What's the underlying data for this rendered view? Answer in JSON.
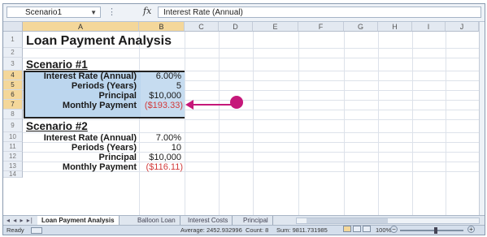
{
  "formula_bar": {
    "name_box": "Scenario1",
    "fx_label": "fx",
    "formula": "Interest Rate (Annual)"
  },
  "columns": [
    "A",
    "B",
    "C",
    "D",
    "E",
    "F",
    "G",
    "H",
    "I",
    "J"
  ],
  "rows": [
    "1",
    "2",
    "3",
    "4",
    "5",
    "6",
    "7",
    "8",
    "9",
    "10",
    "11",
    "12",
    "13",
    "14"
  ],
  "sheet": {
    "title": "Loan Payment Analysis",
    "scenario1": {
      "heading": "Scenario #1",
      "rate_label": "Interest Rate (Annual)",
      "rate_value": "6.00%",
      "periods_label": "Periods (Years)",
      "periods_value": "5",
      "principal_label": "Principal",
      "principal_value": "$10,000",
      "payment_label": "Monthly Payment",
      "payment_value": "($193.33)"
    },
    "scenario2": {
      "heading": "Scenario #2",
      "rate_label": "Interest Rate (Annual)",
      "rate_value": "7.00%",
      "periods_label": "Periods (Years)",
      "periods_value": "10",
      "principal_label": "Principal",
      "principal_value": "$10,000",
      "payment_label": "Monthly Payment",
      "payment_value": "($116.11)"
    }
  },
  "tabs": {
    "nav": "◂ ◂ ▸ ▸|",
    "items": [
      "Loan Payment Analysis",
      "Balloon Loan",
      "Interest Costs",
      "Principal"
    ]
  },
  "status_bar": {
    "ready": "Ready",
    "average": "Average: 2452.932996",
    "count": "Count: 8",
    "sum": "Sum: 9811.731985",
    "zoom": "100%"
  },
  "colors": {
    "selection": "#bcd6ee",
    "callout": "#c5187a",
    "negative": "#d23a3a"
  }
}
